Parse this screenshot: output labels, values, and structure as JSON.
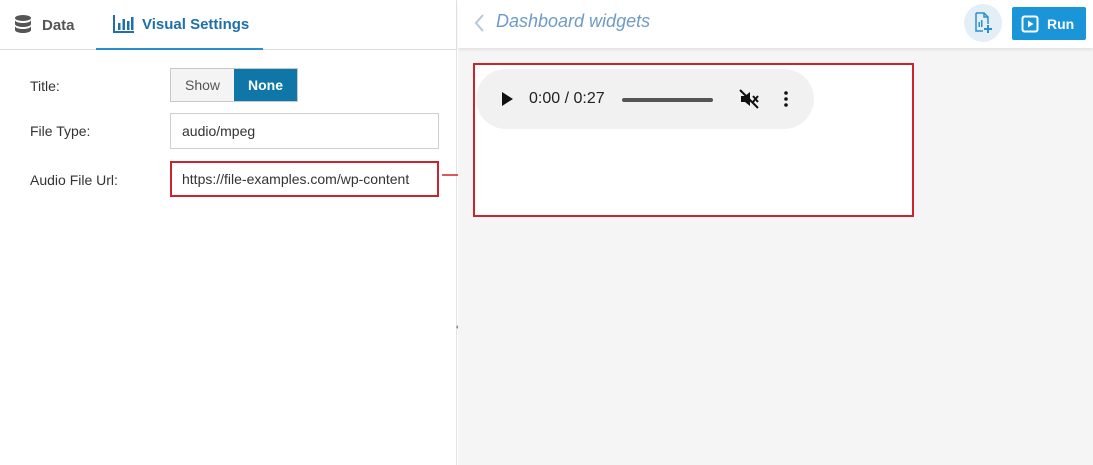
{
  "tabs": {
    "data_label": "Data",
    "visual_label": "Visual Settings",
    "active": "visual"
  },
  "settings": {
    "title_label": "Title:",
    "title_options": [
      "Show",
      "None"
    ],
    "title_selected": "None",
    "file_type_label": "File Type:",
    "file_type_value": "audio/mpeg",
    "audio_url_label": "Audio File Url:",
    "audio_url_value": "https://file-examples.com/wp-content"
  },
  "topbar": {
    "title": "Dashboard widgets",
    "run_label": "Run"
  },
  "player": {
    "time": "0:00 / 0:27",
    "muted": true
  },
  "colors": {
    "accent": "#1a96d8",
    "toggle_active": "#0f76a8",
    "highlight": "#c8252c",
    "title_link": "#6d9bc6"
  },
  "icons": [
    "database-icon",
    "bar-chart-icon",
    "chevron-left-icon",
    "add-file-icon",
    "play-square-icon",
    "play-icon",
    "mute-icon",
    "more-vertical-icon",
    "arrow-right-icon"
  ]
}
